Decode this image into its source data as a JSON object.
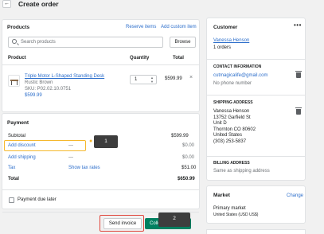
{
  "header": {
    "back_icon": "←",
    "title": "Create order"
  },
  "products": {
    "title": "Products",
    "reserve_items": "Reserve items",
    "add_custom_item": "Add custom item",
    "search_placeholder": "Search products",
    "browse_label": "Browse",
    "col_product": "Product",
    "col_quantity": "Quantity",
    "col_total": "Total",
    "item": {
      "name_line1": "Triple Motor L-Shaped Standing Desk",
      "variant": "Rustic Brown",
      "sku": "SKU: P02.02.10.0751",
      "price": "$599.99",
      "quantity": "1",
      "total": "$599.99",
      "remove_icon": "×"
    }
  },
  "payment": {
    "title": "Payment",
    "subtotal_label": "Subtotal",
    "subtotal_value": "$599.99",
    "discount_label": "Add discount",
    "discount_dash": "—",
    "discount_value": "$0.00",
    "shipping_label": "Add shipping",
    "shipping_dash": "—",
    "shipping_value": "$0.00",
    "tax_label": "Tax",
    "tax_rates_label": "Show tax rates",
    "tax_value": "$51.00",
    "total_label": "Total",
    "total_value": "$650.99",
    "payment_due_later": "Payment due later"
  },
  "actions": {
    "send_invoice": "Send invoice",
    "collect_payment": "Collect p"
  },
  "callouts": {
    "one": "1",
    "two": "2"
  },
  "customer": {
    "title": "Customer",
    "more_icon": "•••",
    "name": "Vanessa Henson",
    "orders": "1 orders",
    "contact_heading": "CONTACT INFORMATION",
    "email": "cutmagicalife@gmail.com",
    "phone": "No phone number",
    "shipping_heading": "SHIPPING ADDRESS",
    "shipping_lines": [
      "Vanessa Henson",
      "13752 Garfield St",
      "Unit D",
      "Thornton CO 80602",
      "United States",
      "(303) 253-5837"
    ],
    "billing_heading": "BILLING ADDRESS",
    "billing_text": "Same as shipping address"
  },
  "market": {
    "title": "Market",
    "change_label": "Change",
    "primary": "Primary market",
    "currency": "United States (USD US$)"
  }
}
